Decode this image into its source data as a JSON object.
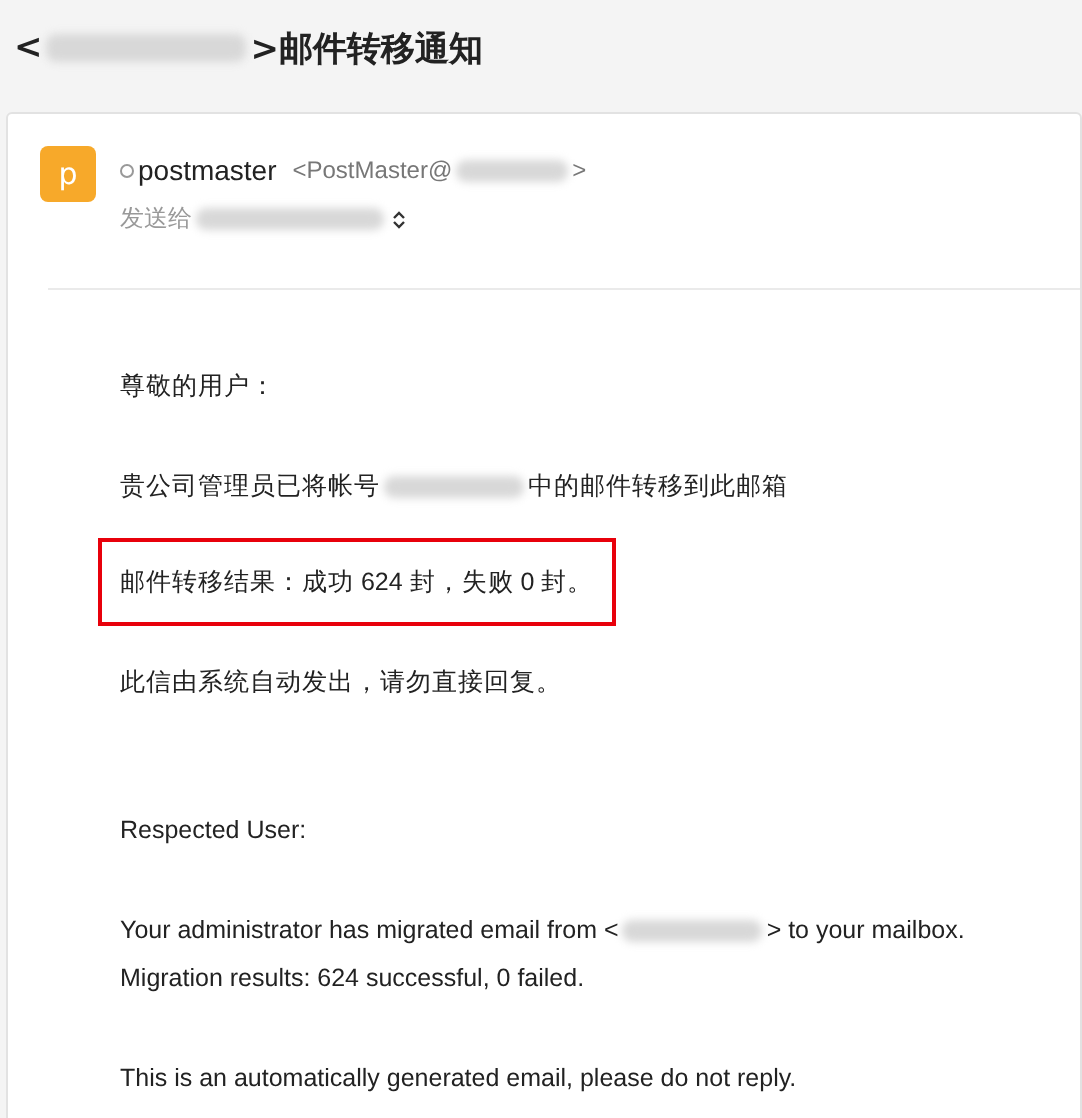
{
  "subject": {
    "before": "<",
    "after": ">邮件转移通知"
  },
  "sender": {
    "avatar": "p",
    "name": "postmaster",
    "address_before": "<PostMaster@",
    "address_after": ">",
    "recipient_label": "发送给"
  },
  "sections": [
    {
      "paragraphs": [
        {
          "highlighted": false,
          "lines": [
            {
              "text": "尊敬的用户："
            }
          ]
        },
        {
          "highlighted": false,
          "lines": [
            {
              "before": "贵公司管理员已将帐号",
              "after": "中的邮件转移到此邮箱"
            }
          ]
        },
        {
          "highlighted": true,
          "lines": [
            {
              "text": "邮件转移结果：成功 624 封，失败 0 封。"
            }
          ]
        },
        {
          "highlighted": false,
          "lines": [
            {
              "text": "此信由系统自动发出，请勿直接回复。"
            }
          ]
        }
      ]
    },
    {
      "paragraphs": [
        {
          "highlighted": false,
          "lines": [
            {
              "text": "Respected User:"
            }
          ]
        },
        {
          "highlighted": false,
          "lines": [
            {
              "before": "Your administrator has migrated email from <",
              "after": "> to your mailbox."
            },
            {
              "text": "Migration results: 624 successful, 0 failed."
            }
          ]
        },
        {
          "highlighted": false,
          "lines": [
            {
              "text": "This is an automatically generated email, please do not reply."
            }
          ]
        }
      ]
    }
  ]
}
